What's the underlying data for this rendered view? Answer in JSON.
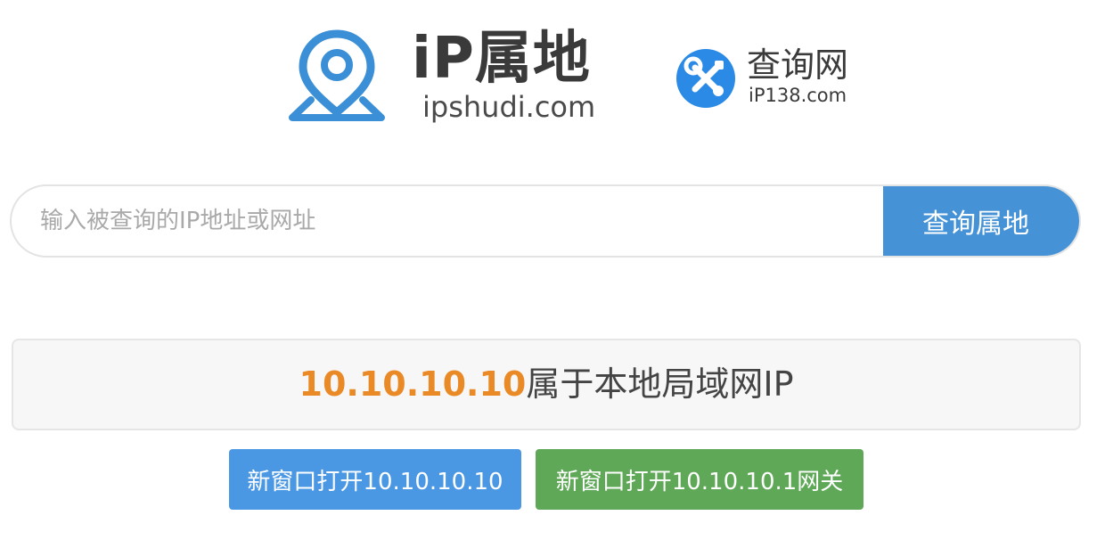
{
  "logos": {
    "ipshudi": {
      "title": "iP属地",
      "domain": "ipshudi.com",
      "icon": "location-pin-icon",
      "color": "#3b8fd6"
    },
    "ip138": {
      "title": "查询网",
      "domain": "iP138.com",
      "icon": "wrench-screwdriver-icon",
      "color": "#2b8ae6"
    }
  },
  "search": {
    "placeholder": "输入被查询的IP地址或网址",
    "value": "",
    "button_label": "查询属地",
    "button_color": "#4592d6"
  },
  "result": {
    "ip": "10.10.10.10",
    "text": "属于本地局域网IP",
    "ip_color": "#ea8a26"
  },
  "actions": {
    "open_label": "新窗口打开10.10.10.10",
    "open_color": "#4a97e4",
    "gateway_label": "新窗口打开10.10.10.1网关",
    "gateway_color": "#5fa857"
  }
}
